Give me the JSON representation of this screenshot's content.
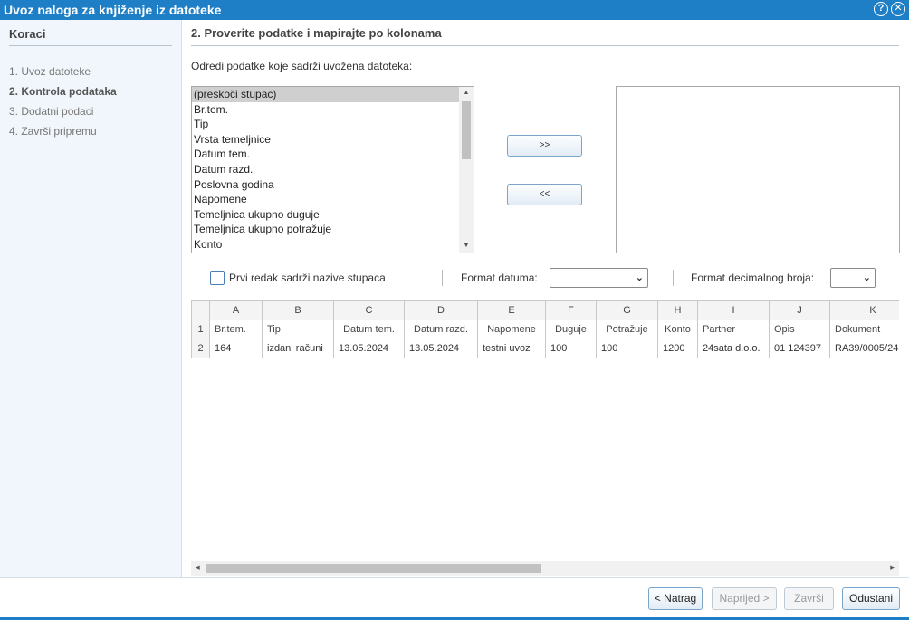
{
  "window": {
    "title": "Uvoz naloga za knjiženje iz datoteke",
    "help_glyph": "?",
    "close_glyph": "✕"
  },
  "sidebar": {
    "title": "Koraci",
    "steps": [
      "1. Uvoz datoteke",
      "2. Kontrola podataka",
      "3. Dodatni podaci",
      "4. Završi pripremu"
    ],
    "active_step": 1
  },
  "main": {
    "title": "2. Proverite podatke i mapirajte po kolonama",
    "instruction": "Odredi podatke koje sadrži uvožena datoteka:",
    "available_fields": [
      "(preskoči stupac)",
      "Br.tem.",
      "Tip",
      "Vrsta temeljnice",
      "Datum tem.",
      "Datum razd.",
      "Poslovna godina",
      "Napomene",
      "Temeljnica ukupno duguje",
      "Temeljnica ukupno potražuje",
      "Konto"
    ],
    "selected_field_index": 0,
    "add_button": ">>",
    "remove_button": "<<",
    "first_row_header_label": "Prvi redak sadrži nazive stupaca",
    "date_format_label": "Format datuma:",
    "decimal_format_label": "Format decimalnog broja:",
    "date_format_value": "",
    "decimal_format_value": ""
  },
  "grid": {
    "column_letters": [
      "A",
      "B",
      "C",
      "D",
      "E",
      "F",
      "G",
      "H",
      "I",
      "J",
      "K"
    ],
    "rows": [
      {
        "num": "1",
        "cells": [
          "Br.tem.",
          "Tip",
          "Datum tem.",
          "Datum razd.",
          "Napomene",
          "Duguje",
          "Potražuje",
          "Konto",
          "Partner",
          "Opis",
          "Dokument"
        ]
      },
      {
        "num": "2",
        "cells": [
          "164",
          "izdani računi",
          "13.05.2024",
          "13.05.2024",
          "testni uvoz",
          "100",
          "100",
          "1200",
          "24sata d.o.o.",
          "01 124397",
          "RA39/0005/24"
        ]
      }
    ]
  },
  "footer": {
    "back": "< Natrag",
    "next": "Naprijed >",
    "finish": "Završi",
    "cancel": "Odustani"
  },
  "colors": {
    "accent": "#1e7fc7",
    "sidebar_bg": "#f0f6fb"
  }
}
